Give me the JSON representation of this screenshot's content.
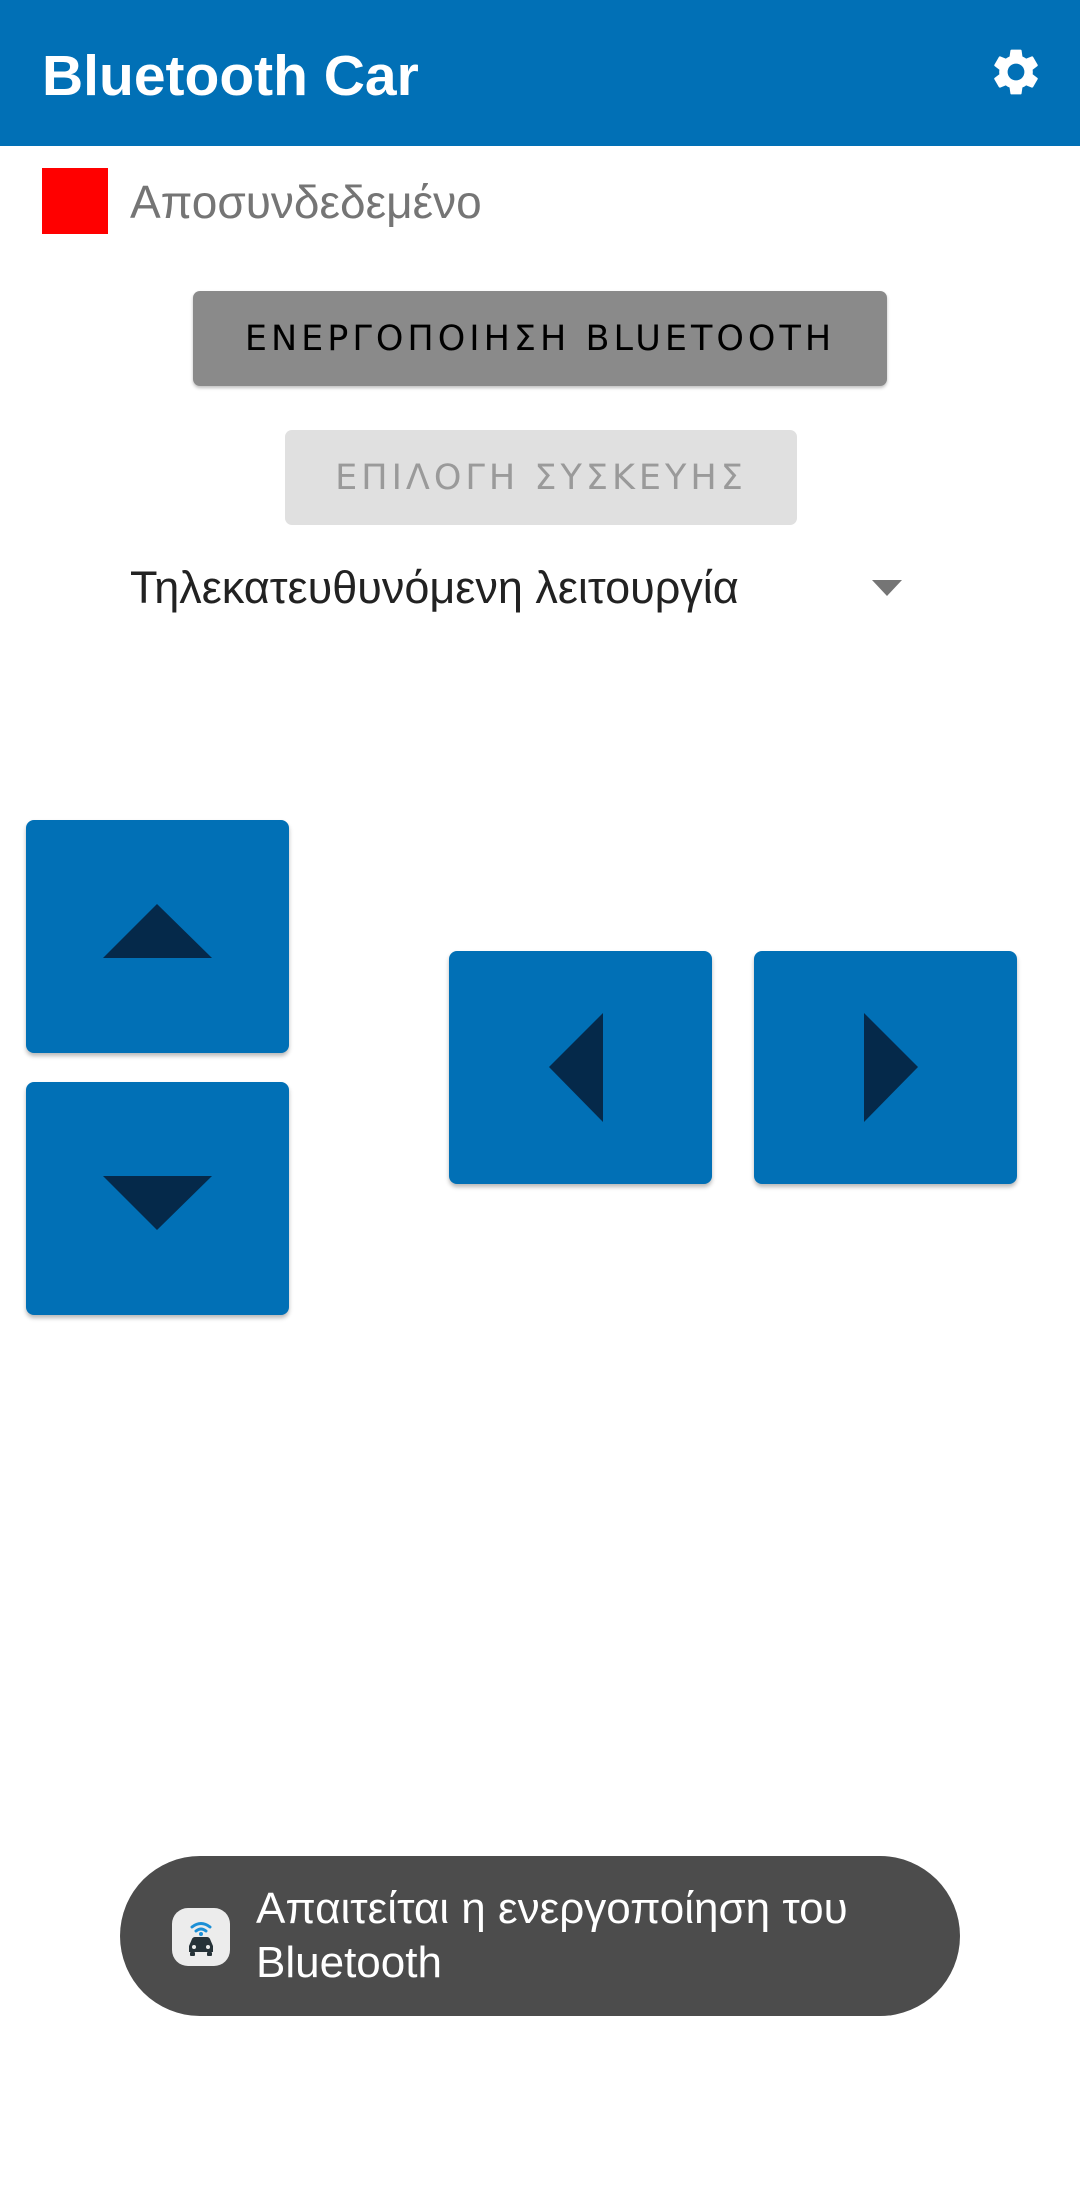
{
  "app": {
    "title": "Bluetooth Car",
    "settings_icon": "gear-icon"
  },
  "status": {
    "label": "Αποσυνδεδεμένο",
    "indicator_color": "#ff0000"
  },
  "buttons": {
    "enable_bluetooth": "ΕΝΕΡΓΟΠΟΙΗΣΗ BLUETOOTH",
    "select_device": "ΕΠΙΛΟΓΗ ΣΥΣΚΕΥΗΣ"
  },
  "mode_select": {
    "value": "Τηλεκατευθυνόμενη λειτουργία"
  },
  "controls": {
    "up_icon": "triangle-up-icon",
    "down_icon": "triangle-down-icon",
    "left_icon": "triangle-left-icon",
    "right_icon": "triangle-right-icon"
  },
  "toast": {
    "message": "Απαιτείται η ενεργοποίηση του Bluetooth",
    "icon": "bluetooth-car-app-icon"
  },
  "colors": {
    "primary": "#0170b6",
    "arrow": "#05294a",
    "toast_bg": "#4c4c4c"
  }
}
